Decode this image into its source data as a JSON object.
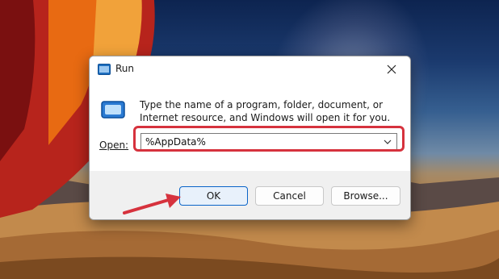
{
  "window": {
    "title": "Run"
  },
  "dialog": {
    "description": "Type the name of a program, folder, document, or Internet resource, and Windows will open it for you.",
    "open_label": "Open:",
    "open_value": "%AppData%"
  },
  "buttons": {
    "ok": "OK",
    "cancel": "Cancel",
    "browse": "Browse..."
  },
  "icons": {
    "title": "run-icon",
    "close": "close-icon",
    "dropdown": "chevron-down-icon",
    "annotation": "red-arrow-icon"
  },
  "colors": {
    "highlight": "#d6323d",
    "ok_border": "#0a64c8",
    "dialog_bg": "#f0f0f0"
  }
}
